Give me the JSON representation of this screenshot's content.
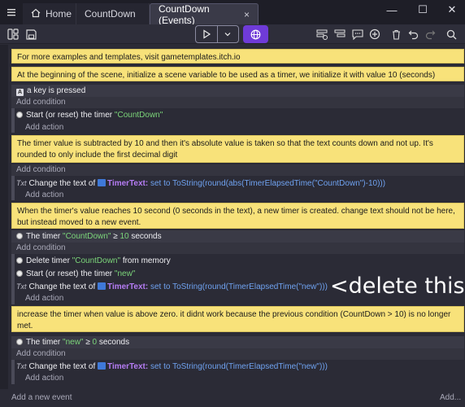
{
  "tabs": [
    {
      "label": "Home"
    },
    {
      "label": "CountDown"
    },
    {
      "label": "CountDown (Events)",
      "close": "×"
    }
  ],
  "window": {
    "minimize": "—",
    "maximize": "☐",
    "close": "✕"
  },
  "comments": {
    "c1": "For more examples and templates, visit gametemplates.itch.io",
    "c2": "At the beginning of the scene, initialize a scene variable to be used as a timer, we initialize it with value 10 (seconds)",
    "c3": "The timer value is subtracted by 10 and then it's absolute value is taken so that the text counts down and not up. It's rounded to only include the first decimal digit",
    "c4": "When the timer's value reaches 10 second (0 seconds in the text), a new timer is created. change text should not be here, but instead moved to a new event.",
    "c5": "increase the timer when value is above zero. it didnt work because the previous condition (CountDown > 10) is no longer met."
  },
  "event1": {
    "condition": "a key is pressed",
    "add_condition": "Add condition",
    "action_prefix": "Start (or reset) the timer",
    "action_timer": "\"CountDown\"",
    "add_action": "Add action"
  },
  "event2": {
    "add_condition": "Add condition",
    "action_prefix": "Change the text of",
    "object": "TimerText:",
    "set_to": "set to",
    "expression": "ToString(round(abs(TimerElapsedTime(\"CountDown\")-10)))",
    "add_action": "Add action"
  },
  "event3": {
    "cond_prefix": "The timer",
    "cond_timer": "\"CountDown\"",
    "cond_op": "≥",
    "cond_value": "10",
    "cond_suffix": "seconds",
    "add_condition": "Add condition",
    "a1_prefix": "Delete timer",
    "a1_timer": "\"CountDown\"",
    "a1_suffix": "from memory",
    "a2_prefix": "Start (or reset) the timer",
    "a2_timer": "\"new\"",
    "a3_prefix": "Change the text of",
    "a3_object": "TimerText:",
    "a3_set": "set to",
    "a3_expression": "ToString(round(TimerElapsedTime(\"new\")))",
    "add_action": "Add action"
  },
  "event4": {
    "cond_prefix": "The timer",
    "cond_timer": "\"new\"",
    "cond_op": "≥",
    "cond_value": "0",
    "cond_suffix": "seconds",
    "add_condition": "Add condition",
    "a1_prefix": "Change the text of",
    "a1_object": "TimerText:",
    "a1_set": "set to",
    "a1_expression": "ToString(round(TimerElapsedTime(\"new\")))",
    "add_action": "Add action"
  },
  "annotation": "<delete this",
  "bottom": {
    "add_event": "Add a new event",
    "add_more": "Add..."
  },
  "icons": {
    "text_instruction": "Txt",
    "key": "A"
  }
}
